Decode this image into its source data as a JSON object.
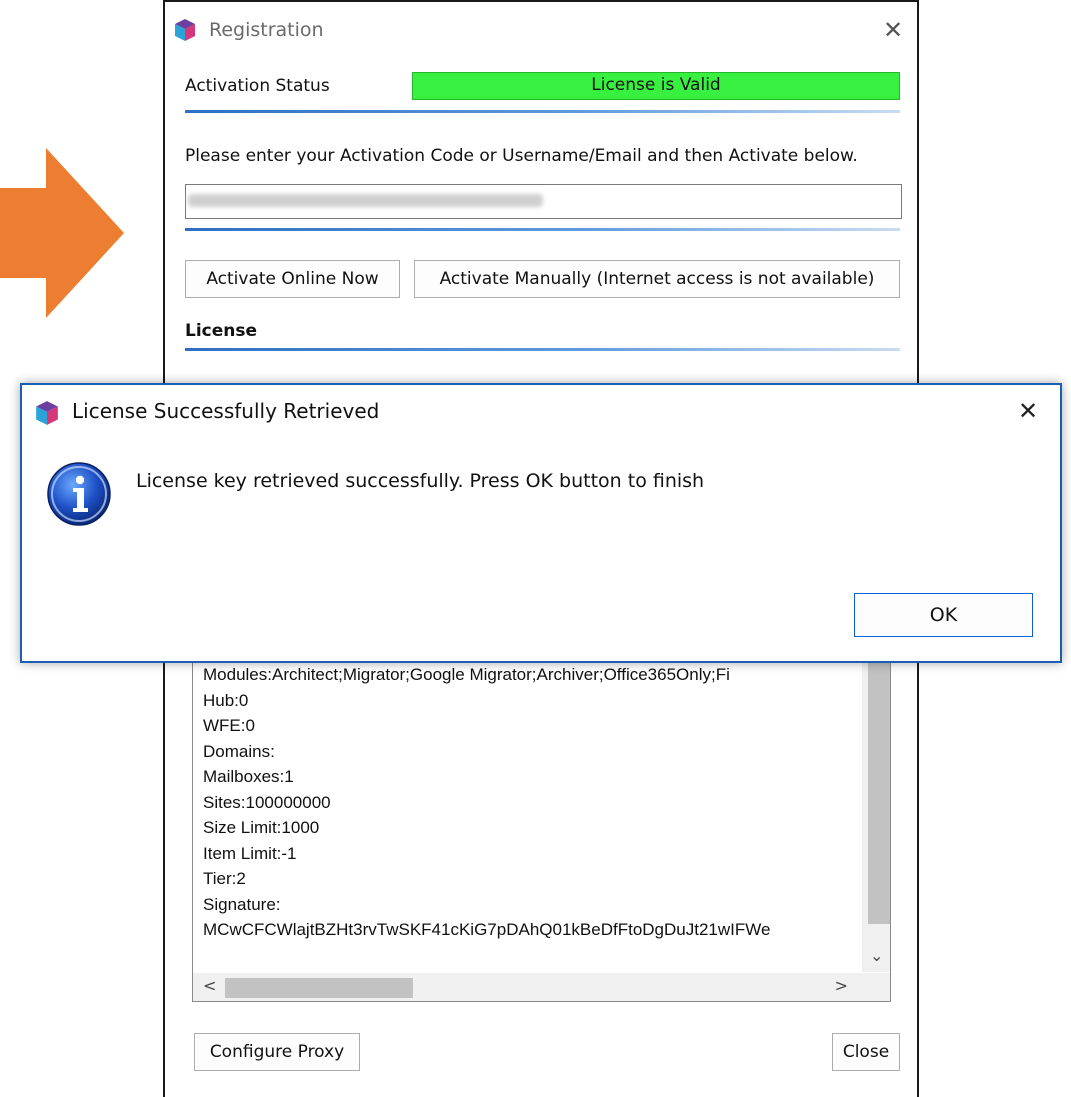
{
  "registration": {
    "title": "Registration",
    "activation_status_label": "Activation Status",
    "status_text": "License is Valid",
    "instruction": "Please enter your Activation Code or Username/Email and then Activate below.",
    "activate_online_button": "Activate Online Now",
    "activate_manually_button": "Activate Manually (Internet access is not available)",
    "license_heading": "License",
    "license_lines": [
      "Modules:Architect;Migrator;Google Migrator;Archiver;Office365Only;Fi",
      "Hub:0",
      "WFE:0",
      "Domains:",
      "Mailboxes:1",
      "Sites:100000000",
      "Size Limit:1000",
      "Item Limit:-1",
      "Tier:2",
      "Signature:",
      "MCwCFCWlajtBZHt3rvTwSKF41cKiG7pDAhQ01kBeDfFtoDgDuJt21wIFWe"
    ],
    "configure_proxy_button": "Configure Proxy",
    "close_button": "Close"
  },
  "message_dialog": {
    "title": "License Successfully Retrieved",
    "message": "License key retrieved successfully. Press OK button to finish",
    "ok_button": "OK"
  },
  "colors": {
    "status_green": "#38f040",
    "arrow_orange": "#ed7d31",
    "dialog_border": "#1a5fb4",
    "separator_blue": "#2f6fc4"
  },
  "icons": [
    "app-logo-icon",
    "close-icon",
    "info-icon",
    "arrow-right-icon",
    "chevron-up-icon",
    "chevron-down-icon",
    "chevron-left-icon",
    "chevron-right-icon"
  ]
}
